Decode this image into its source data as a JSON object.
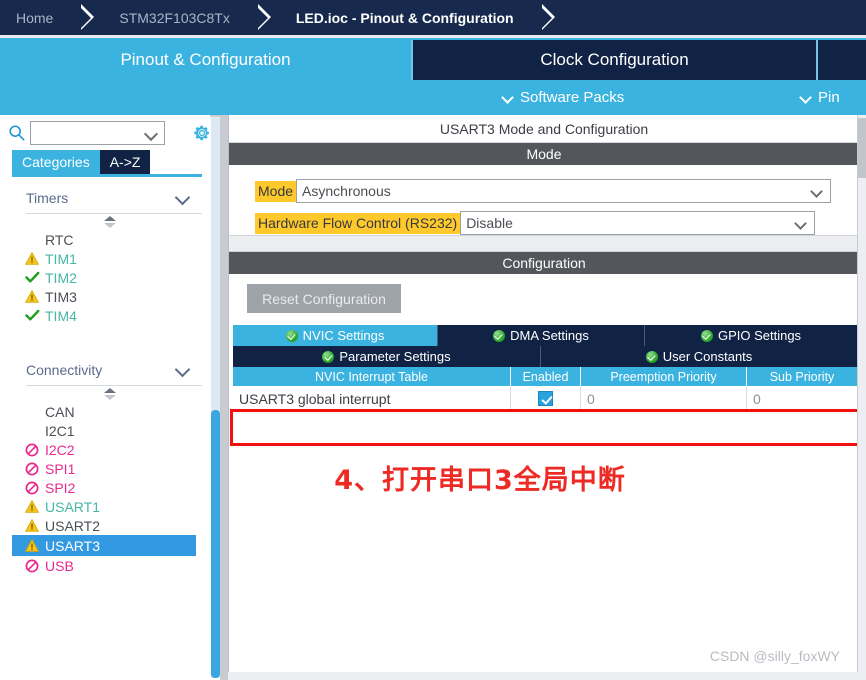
{
  "breadcrumb": {
    "items": [
      {
        "label": "Home",
        "active": false
      },
      {
        "label": "STM32F103C8Tx",
        "active": false
      },
      {
        "label": "LED.ioc - Pinout & Configuration",
        "active": true
      }
    ]
  },
  "main_tabs": [
    {
      "label": "Pinout & Configuration",
      "active": true
    },
    {
      "label": "Clock Configuration",
      "active": false
    },
    {
      "label": "",
      "active": false
    }
  ],
  "sub_strip": {
    "software_packs": "Software Packs",
    "pinout_menu": "Pin",
    "chevron_icon": "chevron-down-icon"
  },
  "sidebar": {
    "search": {
      "value": "",
      "placeholder": "",
      "icon": "search-icon"
    },
    "options_icon": "gear-icon",
    "view_tabs": [
      {
        "label": "Categories",
        "active": true
      },
      {
        "label": "A->Z",
        "active": false
      }
    ],
    "sections": [
      {
        "name": "Timers",
        "items": [
          {
            "label": "RTC",
            "status": "none",
            "color": "#4a4f55"
          },
          {
            "label": "TIM1",
            "status": "warning",
            "color": "#46b6a6"
          },
          {
            "label": "TIM2",
            "status": "ok",
            "color": "#46b6a6"
          },
          {
            "label": "TIM3",
            "status": "warning",
            "color": "#4a4f55"
          },
          {
            "label": "TIM4",
            "status": "ok",
            "color": "#46b6a6"
          }
        ]
      },
      {
        "name": "Connectivity",
        "items": [
          {
            "label": "CAN",
            "status": "none",
            "color": "#4a4f55"
          },
          {
            "label": "I2C1",
            "status": "none",
            "color": "#4a4f55"
          },
          {
            "label": "I2C2",
            "status": "blocked",
            "color": "#e8298e"
          },
          {
            "label": "SPI1",
            "status": "blocked",
            "color": "#e8298e"
          },
          {
            "label": "SPI2",
            "status": "blocked",
            "color": "#e8298e"
          },
          {
            "label": "USART1",
            "status": "warning",
            "color": "#46b6a6"
          },
          {
            "label": "USART2",
            "status": "warning",
            "color": "#4a4f55"
          },
          {
            "label": "USART3",
            "status": "warning",
            "color": "#ffffff",
            "selected": true
          },
          {
            "label": "USB",
            "status": "blocked",
            "color": "#e8298e"
          }
        ]
      }
    ]
  },
  "config_panel": {
    "title": "USART3 Mode and Configuration",
    "mode_section": {
      "header": "Mode",
      "fields": [
        {
          "label": "Mode",
          "value": "Asynchronous"
        },
        {
          "label": "Hardware Flow Control (RS232)",
          "value": "Disable"
        }
      ]
    },
    "configuration_section": {
      "header": "Configuration",
      "reset_button": "Reset Configuration",
      "tabs_row1": [
        {
          "label": "NVIC Settings",
          "active": true
        },
        {
          "label": "DMA Settings",
          "active": false
        },
        {
          "label": "GPIO Settings",
          "active": false
        }
      ],
      "tabs_row2": [
        {
          "label": "Parameter Settings",
          "active": false
        },
        {
          "label": "User Constants",
          "active": false
        }
      ],
      "table": {
        "columns": [
          "NVIC Interrupt Table",
          "Enabled",
          "Preemption Priority",
          "Sub Priority"
        ],
        "rows": [
          {
            "interrupt": "USART3 global interrupt",
            "enabled": true,
            "preemption_priority": "0",
            "sub_priority": "0"
          }
        ]
      }
    }
  },
  "annotation": {
    "text": "4、打开串口3全局中断",
    "color": "#ee2a24"
  },
  "watermark": "CSDN @silly_foxWY",
  "colors": {
    "accent_blue": "#3bb3e0",
    "dark_navy": "#112345",
    "breadcrumb_navy": "#172a4d",
    "highlight_yellow": "#ffc92b",
    "annotation_red": "#ee2a24",
    "selection_blue": "#3399e0"
  }
}
